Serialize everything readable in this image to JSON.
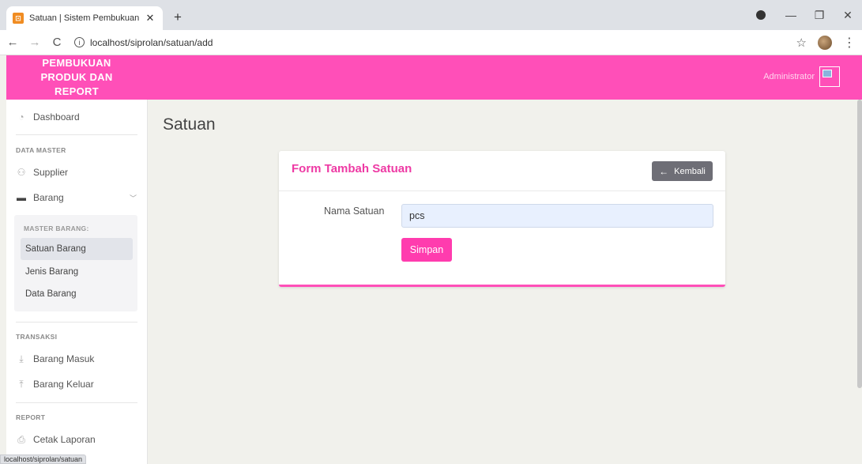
{
  "browser": {
    "tab_title": "Satuan | Sistem Pembukuan Prod",
    "tab_favicon": "app-favicon",
    "new_tab": "+",
    "url": "localhost/siprolan/satuan/add",
    "status_url": "localhost/siprolan/satuan"
  },
  "header": {
    "brand": "PEMBUKUAN PRODUK DAN REPORT",
    "user_name": "Administrator",
    "color": "#ff4fb8"
  },
  "sidebar": {
    "dashboard": "Dashboard",
    "section_master": "DATA MASTER",
    "supplier": "Supplier",
    "barang": "Barang",
    "submenu_title": "MASTER BARANG:",
    "sub_items": [
      "Satuan Barang",
      "Jenis Barang",
      "Data Barang"
    ],
    "section_transaksi": "TRANSAKSI",
    "barang_masuk": "Barang Masuk",
    "barang_keluar": "Barang Keluar",
    "section_report": "REPORT",
    "cetak_laporan": "Cetak Laporan"
  },
  "main": {
    "page_title": "Satuan",
    "card_title": "Form Tambah Satuan",
    "back_label": "Kembali",
    "field_label": "Nama Satuan",
    "field_value": "pcs",
    "submit_label": "Simpan"
  }
}
